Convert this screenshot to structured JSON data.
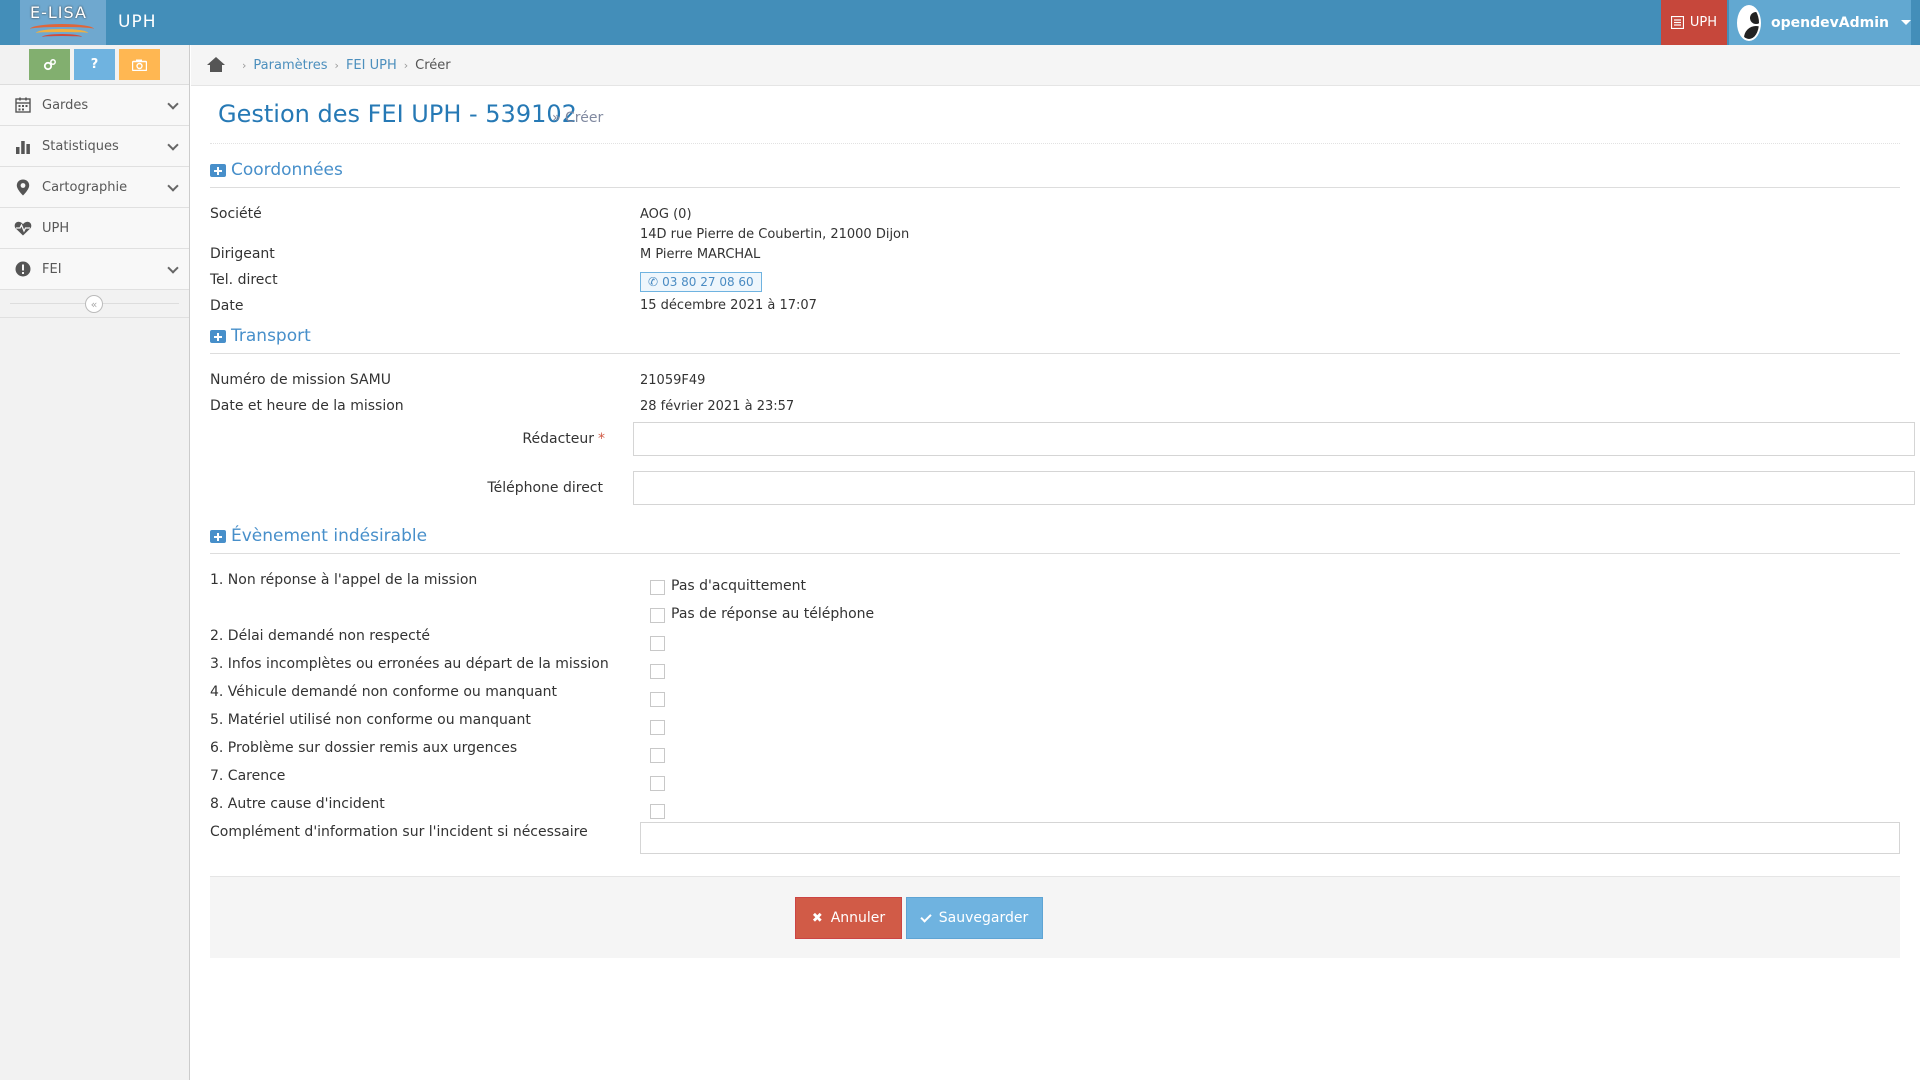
{
  "app": {
    "logo_text": "E-LISA",
    "name": "UPH"
  },
  "navbar": {
    "module_label": "UPH",
    "username": "opendevAdmin"
  },
  "sidebar": {
    "shortcuts": [
      {
        "label": "⚙",
        "color": "#82af6f"
      },
      {
        "label": "?",
        "color": "#6fb3e0"
      },
      {
        "label": "◉",
        "color": "#ffb752"
      }
    ],
    "items": [
      {
        "label": "Gardes",
        "icon": "calendar-icon",
        "expandable": true
      },
      {
        "label": "Statistiques",
        "icon": "bar-chart-icon",
        "expandable": true
      },
      {
        "label": "Cartographie",
        "icon": "map-marker-icon",
        "expandable": true
      },
      {
        "label": "UPH",
        "icon": "heartbeat-icon",
        "expandable": false
      },
      {
        "label": "FEI",
        "icon": "exclamation-circle-icon",
        "expandable": true
      }
    ],
    "collapse_label": "«"
  },
  "breadcrumb": {
    "items": [
      "Paramètres",
      "FEI UPH"
    ],
    "active": "Créer"
  },
  "page": {
    "title": "Gestion des FEI UPH - 539102",
    "subtitle": "» Créer"
  },
  "coordonnees": {
    "title": "Coordonnées",
    "societe_label": "Société",
    "societe_value": "AOG (0)",
    "address": "14D rue Pierre de Coubertin, 21000 Dijon",
    "dirigeant_label": "Dirigeant",
    "dirigeant_value": "M Pierre MARCHAL",
    "tel_label": "Tel. direct",
    "tel_value": "03 80 27 08 60",
    "date_label": "Date",
    "date_value": "15 décembre 2021 à 17:07"
  },
  "transport": {
    "title": "Transport",
    "mission_label": "Numéro de mission SAMU",
    "mission_value": "21059F49",
    "mission_date_label": "Date et heure de la mission",
    "mission_date_value": "28 février 2021 à 23:57",
    "redacteur_label": "Rédacteur",
    "redacteur_required": "*",
    "redacteur_value": "",
    "telephone_label": "Téléphone direct",
    "telephone_value": ""
  },
  "evenement": {
    "title": "Évènement indésirable",
    "q1_label": "1. Non réponse à l'appel de la mission",
    "q1_options": [
      "Pas d'acquittement",
      "Pas de réponse au téléphone"
    ],
    "items": [
      "2. Délai demandé non respecté",
      "3. Infos incomplètes ou erronées au départ de la mission",
      "4. Véhicule demandé non conforme ou manquant",
      "5. Matériel utilisé non conforme ou manquant",
      "6. Problème sur dossier remis aux urgences",
      "7. Carence",
      "8. Autre cause d'incident"
    ],
    "complement_label": "Complément d'information sur l'incident si nécessaire",
    "complement_value": ""
  },
  "actions": {
    "cancel_label": "Annuler",
    "save_label": "Sauvegarder"
  },
  "colors": {
    "navbar": "#438eb9",
    "accent": "#478fca",
    "danger": "#d15b47",
    "primary": "#6fb3e0"
  }
}
